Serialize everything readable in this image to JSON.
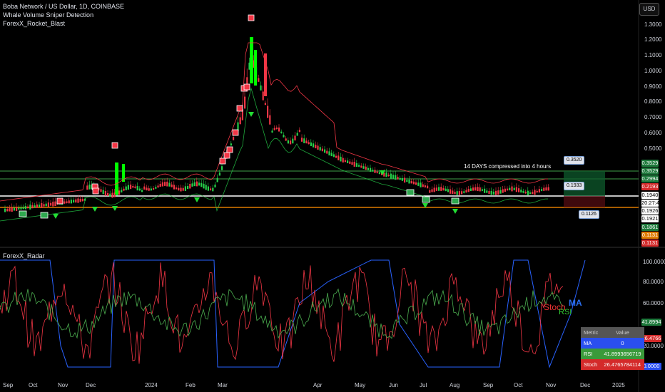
{
  "header": {
    "title": "Boba Network / US Dollar, 1D, COINBASE",
    "indicator1": "Whale Volume Sniper Detection",
    "indicator2": "ForexX_Rocket_Blast",
    "currency_button": "USD"
  },
  "price_axis": {
    "ticks": [
      "1.3000",
      "1.2000",
      "1.1000",
      "1.0000",
      "0.9000",
      "0.8000",
      "0.7000",
      "0.6000",
      "0.5000"
    ],
    "badges": [
      {
        "text": "0.3529",
        "color": "#1e7a3c"
      },
      {
        "text": "0.3529",
        "color": "#1e7a3c"
      },
      {
        "text": "0.2994",
        "color": "#1e7a3c"
      },
      {
        "text": "0.2193",
        "color": "#d42a2a"
      },
      {
        "text": "0.1940",
        "color": "#ffffff",
        "fg": "#000000"
      },
      {
        "text": "20:27:42",
        "color": "#ffffff",
        "fg": "#000000"
      },
      {
        "text": "0.1926",
        "color": "#ffffff",
        "fg": "#000000"
      },
      {
        "text": "0.1921",
        "color": "#ffffff",
        "fg": "#000000"
      },
      {
        "text": "0.1861",
        "color": "#1e7a3c"
      },
      {
        "text": "0.1131",
        "color": "#e07b00"
      },
      {
        "text": "0.1131",
        "color": "#d42a2a"
      }
    ]
  },
  "annotation": {
    "text": "14 DAYS compressed into 4 hours",
    "callout_top": "0.3520",
    "callout_mid": "0.1933",
    "callout_low": "0.1126"
  },
  "radar": {
    "title": "ForexX_Radar",
    "ticks": [
      "100.0000",
      "80.0000",
      "60.0000",
      "40.0000",
      "20.0000"
    ],
    "badges": [
      {
        "text": "41.8994",
        "color": "#1e7a3c"
      },
      {
        "text": "26.4766",
        "color": "#d42a2a"
      },
      {
        "text": "0.0000",
        "color": "#2a4ff0"
      }
    ],
    "labels": {
      "stoch": "Stoch",
      "rsi": "RSI",
      "ma": "MA"
    },
    "legend": {
      "header": [
        "Metric",
        "Value"
      ],
      "rows": [
        {
          "name": "MA",
          "value": "0",
          "color": "#2a4ff0"
        },
        {
          "name": "RSI",
          "value": "41.8993656719",
          "color": "#3a9a3a"
        },
        {
          "name": "Stoch",
          "value": "26.4765784114",
          "color": "#d42a2a"
        }
      ]
    }
  },
  "time_axis": [
    "Sep",
    "Oct",
    "Nov",
    "Dec",
    "2024",
    "Feb",
    "Mar",
    "Apr",
    "May",
    "Jun",
    "Jul",
    "Aug",
    "Sep",
    "Oct",
    "Nov",
    "Dec",
    "2025"
  ],
  "colors": {
    "up": "#26d04a",
    "down": "#f23645",
    "bright_up": "#00ff00",
    "ma": "#2962ff",
    "rsi": "#4caf50",
    "stoch": "#f23645"
  }
}
